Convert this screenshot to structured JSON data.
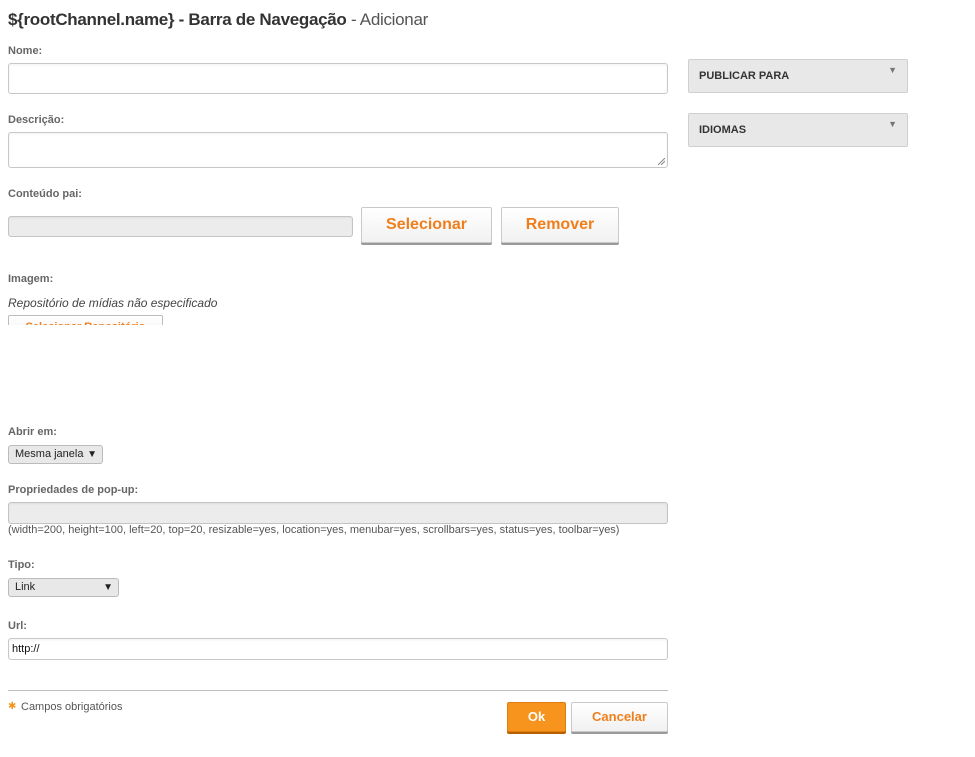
{
  "header": {
    "title_main": "${rootChannel.name} - Barra de Navegação",
    "title_sub": "- Adicionar"
  },
  "form": {
    "name_label": "Nome:",
    "name_value": "",
    "description_label": "Descrição:",
    "description_value": "",
    "parent_label": "Conteúdo pai:",
    "parent_value": "",
    "select_button": "Selecionar",
    "remove_button": "Remover",
    "image_label": "Imagem:",
    "image_status": "Repositório de mídias não especificado",
    "image_select_button": "Selecionar Repositório",
    "open_in_label": "Abrir em:",
    "open_in_value": "Mesma janela",
    "popup_label": "Propriedades de pop-up:",
    "popup_value": "",
    "popup_hint": "(width=200, height=100, left=20, top=20, resizable=yes, location=yes, menubar=yes, scrollbars=yes, status=yes, toolbar=yes)",
    "type_label": "Tipo:",
    "type_value": "Link",
    "url_label": "Url:",
    "url_value": "http://"
  },
  "footer": {
    "required_note": "Campos obrigatórios",
    "ok_button": "Ok",
    "cancel_button": "Cancelar"
  },
  "sidebar": {
    "publish_panel": "PUBLICAR PARA",
    "languages_panel": "IDIOMAS"
  },
  "colors": {
    "accent": "#f7941d",
    "accent_text": "#f07f1b"
  },
  "icons": {
    "dropdown": "triangle-down",
    "required": "asterisk"
  }
}
